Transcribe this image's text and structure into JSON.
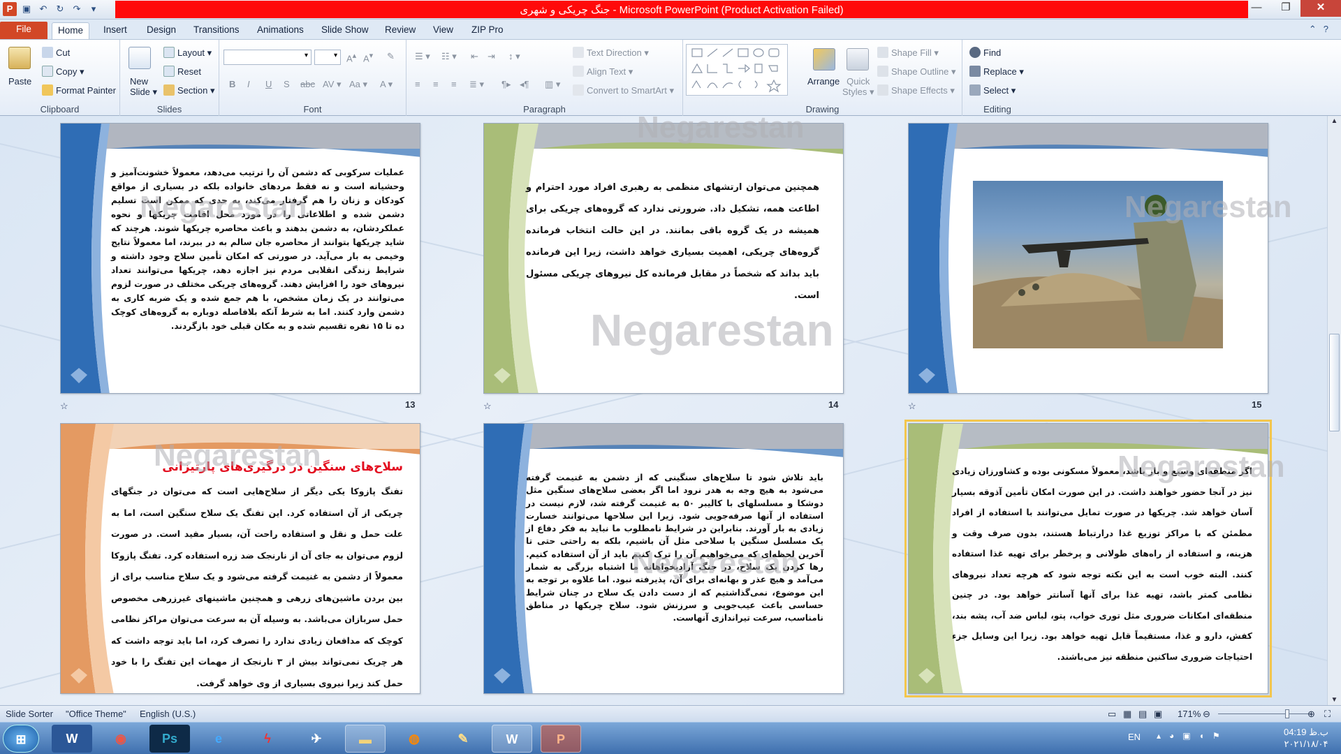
{
  "window": {
    "title": "جنگ چریکی و شهری  -  Microsoft PowerPoint (Product Activation Failed)"
  },
  "tabs": [
    "File",
    "Home",
    "Insert",
    "Design",
    "Transitions",
    "Animations",
    "Slide Show",
    "Review",
    "View",
    "ZIP Pro"
  ],
  "ribbon": {
    "clipboard": {
      "label": "Clipboard",
      "paste": "Paste",
      "cut": "Cut",
      "copy": "Copy",
      "format_painter": "Format Painter"
    },
    "slides": {
      "label": "Slides",
      "new_slide_1": "New",
      "new_slide_2": "Slide",
      "layout": "Layout",
      "reset": "Reset",
      "section": "Section"
    },
    "font": {
      "label": "Font"
    },
    "paragraph": {
      "label": "Paragraph",
      "text_direction": "Text Direction",
      "align_text": "Align Text",
      "convert": "Convert to SmartArt"
    },
    "drawing": {
      "label": "Drawing",
      "arrange": "Arrange",
      "quick_1": "Quick",
      "quick_2": "Styles",
      "shape_fill": "Shape Fill",
      "shape_outline": "Shape Outline",
      "shape_effects": "Shape Effects"
    },
    "editing": {
      "label": "Editing",
      "find": "Find",
      "replace": "Replace",
      "select": "Select"
    }
  },
  "watermark": "Negarestan",
  "slides": [
    {
      "num": "13",
      "text": "عملیات سرکوبی که دشمن آن را ترتیب می‌دهد، معمولاً خشونت‌آمیز و وحشیانه است و نه فقط مردهای خانواده بلکه در بسیاری از مواقع کودکان و زنان را هم گرفتار می‌کند، به حدی که ممکن است تسلیم دشمن شده و اطلاعاتی را در مورد محل اقامت چریکها و نحوه عملکردشان، به دشمن بدهند و باعث محاصره چریکها شوند. هرچند که شاید چریکها بتوانند از محاصره جان سالم به در ببرند، اما معمولاً نتایج وخیمی به بار می‌آید. در صورتی که امکان تأمین سلاح وجود داشته و شرایط زندگی انقلابی مردم نیز اجازه دهد، چریکها می‌توانند تعداد نیروهای خود را افزایش دهند. گروه‌های چریکی مختلف در صورت لزوم می‌توانند در یک زمان مشخص، با هم جمع شده و یک ضربه کاری به دشمن وارد کنند. اما به شرط آنکه بلافاصله دوباره به گروه‌های کوچک ده تا ۱۵ نفره تقسیم شده و به مکان قبلی خود بازگردند."
    },
    {
      "num": "14",
      "text": "همچنین می‌توان ارتشهای منظمی به رهبری افراد مورد احترام و اطاعت همه، تشکیل داد. ضرورتی ندارد که گروه‌های چریکی برای همیشه در یک گروه باقی بمانند. در این حالت انتخاب فرمانده گروه‌های چریکی، اهمیت بسیاری خواهد داشت، زیرا این فرمانده باید بداند که شخصاً در مقابل فرمانده کل نیروهای چریکی مسئول است."
    },
    {
      "num": "15"
    },
    {
      "title": "سلاح‌های سنگین در درگیری‌های پارتیزانی",
      "text": "تفنگ پازوکا یکی دیگر از سلاح‌هایی است که می‌توان در جنگهای چریکی از آن استفاده کرد. این تفنگ یک سلاح سنگین است، اما به علت حمل و نقل و استفاده راحت آن، بسیار مفید است. در صورت لزوم می‌توان به جای آن از نارنجک ضد زره استفاده کرد. تفنگ پازوکا معمولاً از دشمن به غنیمت گرفته می‌شود و یک سلاح مناسب برای از بین بردن ماشین‌های زرهی و همچنین ماشینهای غیرزرهی مخصوص حمل سربازان می‌باشد. به وسیله آن به سرعت می‌توان مراکز نظامی کوچک که مدافعان زیادی ندارد را تصرف کرد، اما باید توجه داشت که هر چریک نمی‌تواند بیش از ۳ نارنجک از مهمات این تفنگ را با خود حمل کند زیرا نیروی بسیاری از وی خواهد گرفت."
    },
    {
      "text": "باید تلاش شود تا سلاح‌های سنگینی که از دشمن به غنیمت گرفته می‌شود به هیچ وجه به هدر نرود اما اگر بعضی سلاح‌های سنگین مثل دوشکا و مسلسلهای با کالیبر ۵۰ به غنیمت گرفته شد، لازم نیست در استفاده از آنها صرفه‌جویی شود. زیرا این سلاحها می‌توانند خسارت زیادی به بار آورند. بنابراین در شرایط نامطلوب ما نباید به فکر دفاع از یک مسلسل سنگین یا سلاحی مثل آن باشیم، بلکه به راحتی حتی تا آخرین لحظه‌ای که می‌خواهیم آن را ترک کنیم باید از آن استفاده کنیم. رها کردن یک سلاح، در جنگ آزادیخواهانه ما اشتباه بزرگی به شمار می‌آمد و هیچ عذر و بهانه‌ای برای آن، پذیرفته نبود. اما علاوه بر توجه به این موضوع، نمی‌گذاشتیم که از دست دادن یک سلاح در چنان شرایط حساسی باعث عیب‌جویی و سرزنش شود. سلاح چریکها در مناطق نامناسب، سرعت تیراندازی آنهاست."
    },
    {
      "text": "اگر منطقه‌ای وسیع و باز باشد، معمولاً مسکونی بوده و کشاورزان زیادی نیز در آنجا حضور خواهند داشت. در این صورت امکان تأمین آذوقه بسیار آسان خواهد شد. چریکها در صورت تمایل می‌توانند با استفاده از افراد مطمئن که با مراکز توزیع غذا درارتباط هستند، بدون صرف وقت و هزینه، و استفاده از راه‌های طولانی و پرخطر برای تهیه غذا استفاده کنند. البته خوب است به این نکته توجه شود که هرچه تعداد نیروهای نظامی کمتر باشد، تهیه غذا برای آنها آسانتر خواهد بود. در چنین منطقه‌ای امکانات ضروری مثل توری خواب، پتو، لباس ضد آب، پشه بند، کفش، دارو و غذا، مستقیماً قابل تهیه خواهد بود. زیرا این وسایل جزء احتیاجات ضروری ساکنین منطقه نیز می‌باشند."
    }
  ],
  "statusbar": {
    "view": "Slide Sorter",
    "theme": "\"Office Theme\"",
    "lang": "English (U.S.)",
    "zoom": "171%"
  },
  "taskbar": {
    "lang": "EN",
    "time": "04:19 ب.ظ",
    "date": "۲۰۲۱/۱۸/۰۴"
  }
}
